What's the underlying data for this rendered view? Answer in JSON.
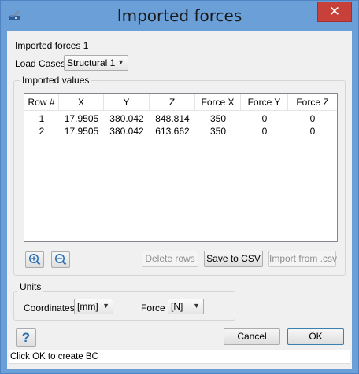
{
  "window": {
    "title": "Imported forces",
    "close_glyph": "✕"
  },
  "header": {
    "name": "Imported forces 1"
  },
  "load_cases": {
    "label": "Load Cases",
    "value": "Structural 1"
  },
  "imported_values": {
    "group_title": "Imported values",
    "columns": [
      "Row #",
      "X",
      "Y",
      "Z",
      "Force X",
      "Force Y",
      "Force Z"
    ],
    "rows": [
      [
        "1",
        "17.9505",
        "380.042",
        "848.814",
        "350",
        "0",
        "0"
      ],
      [
        "2",
        "17.9505",
        "380.042",
        "613.662",
        "350",
        "0",
        "0"
      ]
    ]
  },
  "table_actions": {
    "zoom_in_icon": "zoom-in-icon",
    "zoom_out_icon": "zoom-out-icon",
    "delete_rows": "Delete rows",
    "save_csv": "Save to CSV",
    "import_csv": "Import from .csv"
  },
  "units": {
    "group_title": "Units",
    "coordinates_label": "Coordinates",
    "coordinates_value": "[mm]",
    "force_label": "Force",
    "force_value": "[N]"
  },
  "footer": {
    "help_glyph": "?",
    "cancel": "Cancel",
    "ok": "OK",
    "status": "Click OK to create BC"
  },
  "colors": {
    "titlebar": "#6b9fd8",
    "close_button": "#c7403a",
    "dialog_bg": "#f0f0f0",
    "icon_blue": "#2d6fae"
  }
}
